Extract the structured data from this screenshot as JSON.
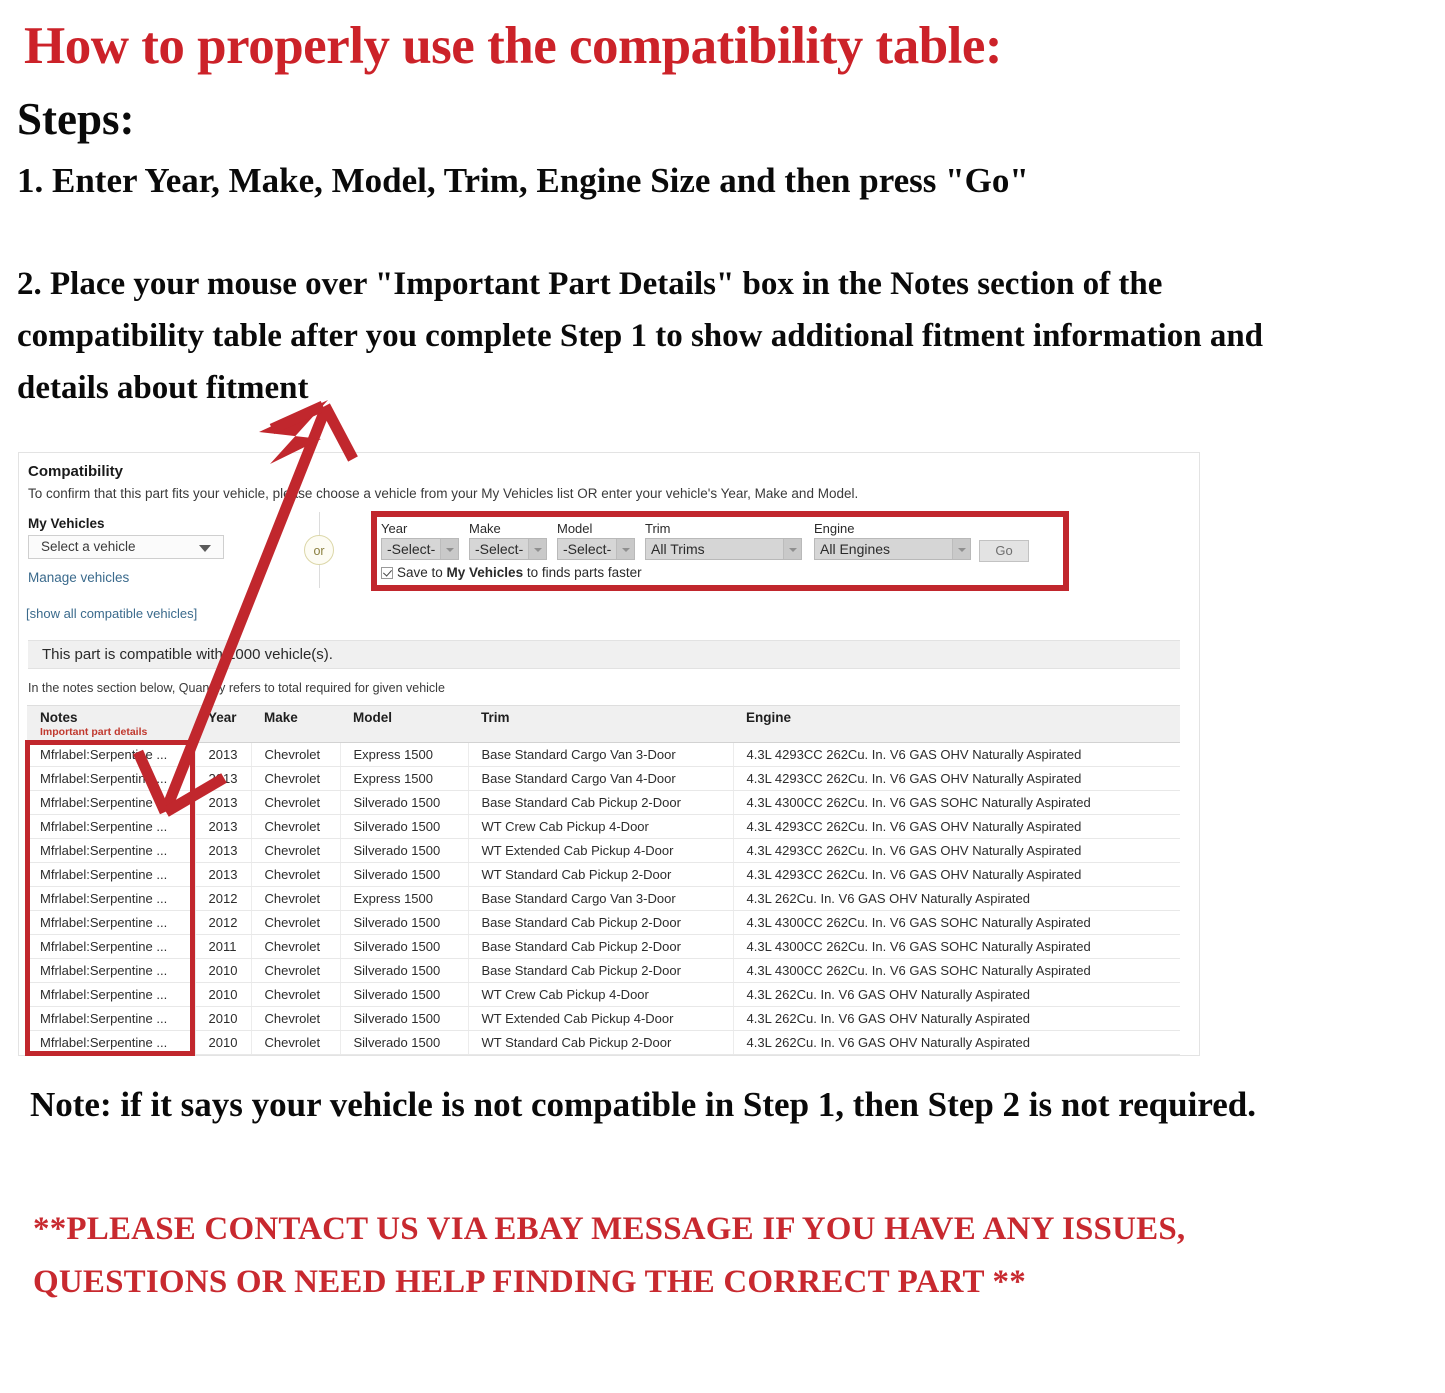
{
  "instructions": {
    "headline": "How to properly use the compatibility table:",
    "steps_label": "Steps:",
    "step1": "1. Enter Year, Make, Model, Trim, Engine Size and then press \"Go\"",
    "step2": "2. Place your mouse over \"Important Part Details\" box in the Notes section of the compatibility table after you complete Step 1 to show additional fitment information and details about fitment",
    "note": "Note: if it says your vehicle is not compatible in Step 1, then Step 2 is not required.",
    "contact": "**PLEASE CONTACT US VIA EBAY MESSAGE IF YOU HAVE ANY ISSUES, QUESTIONS OR NEED HELP FINDING THE CORRECT PART **"
  },
  "colors": {
    "headline_red": "#CC2229",
    "highlight_red": "#C1272D",
    "link_blue": "#3A6A8C",
    "notes_sub_red": "#C0392F"
  },
  "compatibility": {
    "title": "Compatibility",
    "subtitle": "To confirm that this part fits your vehicle, please choose a vehicle from your My Vehicles list OR enter your vehicle's Year, Make and Model.",
    "my_vehicles": {
      "label": "My Vehicles",
      "select_value": "Select a vehicle",
      "manage_link": "Manage vehicles"
    },
    "or_divider": "or",
    "show_all_link": "[show all compatible vehicles]",
    "finder": {
      "fields": [
        {
          "label": "Year",
          "value": "-Select-"
        },
        {
          "label": "Make",
          "value": "-Select-"
        },
        {
          "label": "Model",
          "value": "-Select-"
        },
        {
          "label": "Trim",
          "value": "All Trims"
        },
        {
          "label": "Engine",
          "value": "All Engines"
        }
      ],
      "go_label": "Go",
      "save_checked": true,
      "save_text_before": "Save to ",
      "save_text_bold": "My Vehicles",
      "save_text_after": " to finds parts faster"
    },
    "banner": "This part is compatible with 1000 vehicle(s).",
    "qty_note": "In the notes section below, Quantity refers to total required for given vehicle",
    "table": {
      "headers": {
        "notes": "Notes",
        "notes_sub": "Important part details",
        "year": "Year",
        "make": "Make",
        "model": "Model",
        "trim": "Trim",
        "engine": "Engine"
      },
      "rows": [
        {
          "notes": "Mfrlabel:Serpentine ...",
          "year": "2013",
          "make": "Chevrolet",
          "model": "Express 1500",
          "trim": "Base Standard Cargo Van 3-Door",
          "engine": "4.3L 4293CC 262Cu. In. V6 GAS OHV Naturally Aspirated"
        },
        {
          "notes": "Mfrlabel:Serpentine ...",
          "year": "2013",
          "make": "Chevrolet",
          "model": "Express 1500",
          "trim": "Base Standard Cargo Van 4-Door",
          "engine": "4.3L 4293CC 262Cu. In. V6 GAS OHV Naturally Aspirated"
        },
        {
          "notes": "Mfrlabel:Serpentine ...",
          "year": "2013",
          "make": "Chevrolet",
          "model": "Silverado 1500",
          "trim": "Base Standard Cab Pickup 2-Door",
          "engine": "4.3L 4300CC 262Cu. In. V6 GAS SOHC Naturally Aspirated"
        },
        {
          "notes": "Mfrlabel:Serpentine ...",
          "year": "2013",
          "make": "Chevrolet",
          "model": "Silverado 1500",
          "trim": "WT Crew Cab Pickup 4-Door",
          "engine": "4.3L 4293CC 262Cu. In. V6 GAS OHV Naturally Aspirated"
        },
        {
          "notes": "Mfrlabel:Serpentine ...",
          "year": "2013",
          "make": "Chevrolet",
          "model": "Silverado 1500",
          "trim": "WT Extended Cab Pickup 4-Door",
          "engine": "4.3L 4293CC 262Cu. In. V6 GAS OHV Naturally Aspirated"
        },
        {
          "notes": "Mfrlabel:Serpentine ...",
          "year": "2013",
          "make": "Chevrolet",
          "model": "Silverado 1500",
          "trim": "WT Standard Cab Pickup 2-Door",
          "engine": "4.3L 4293CC 262Cu. In. V6 GAS OHV Naturally Aspirated"
        },
        {
          "notes": "Mfrlabel:Serpentine ...",
          "year": "2012",
          "make": "Chevrolet",
          "model": "Express 1500",
          "trim": "Base Standard Cargo Van 3-Door",
          "engine": "4.3L 262Cu. In. V6 GAS OHV Naturally Aspirated"
        },
        {
          "notes": "Mfrlabel:Serpentine ...",
          "year": "2012",
          "make": "Chevrolet",
          "model": "Silverado 1500",
          "trim": "Base Standard Cab Pickup 2-Door",
          "engine": "4.3L 4300CC 262Cu. In. V6 GAS SOHC Naturally Aspirated"
        },
        {
          "notes": "Mfrlabel:Serpentine ...",
          "year": "2011",
          "make": "Chevrolet",
          "model": "Silverado 1500",
          "trim": "Base Standard Cab Pickup 2-Door",
          "engine": "4.3L 4300CC 262Cu. In. V6 GAS SOHC Naturally Aspirated"
        },
        {
          "notes": "Mfrlabel:Serpentine ...",
          "year": "2010",
          "make": "Chevrolet",
          "model": "Silverado 1500",
          "trim": "Base Standard Cab Pickup 2-Door",
          "engine": "4.3L 4300CC 262Cu. In. V6 GAS SOHC Naturally Aspirated"
        },
        {
          "notes": "Mfrlabel:Serpentine ...",
          "year": "2010",
          "make": "Chevrolet",
          "model": "Silverado 1500",
          "trim": "WT Crew Cab Pickup 4-Door",
          "engine": "4.3L 262Cu. In. V6 GAS OHV Naturally Aspirated"
        },
        {
          "notes": "Mfrlabel:Serpentine ...",
          "year": "2010",
          "make": "Chevrolet",
          "model": "Silverado 1500",
          "trim": "WT Extended Cab Pickup 4-Door",
          "engine": "4.3L 262Cu. In. V6 GAS OHV Naturally Aspirated"
        },
        {
          "notes": "Mfrlabel:Serpentine ...",
          "year": "2010",
          "make": "Chevrolet",
          "model": "Silverado 1500",
          "trim": "WT Standard Cab Pickup 2-Door",
          "engine": "4.3L 262Cu. In. V6 GAS OHV Naturally Aspirated"
        }
      ]
    }
  }
}
